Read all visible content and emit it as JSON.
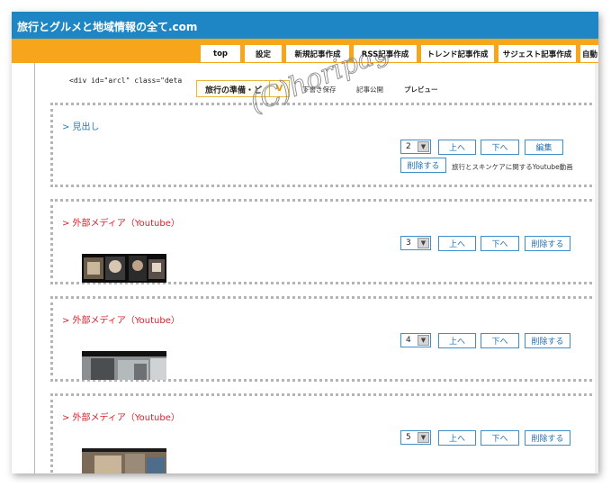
{
  "site": {
    "title": "旅行とグルメと地域情報の全て.com"
  },
  "nav": {
    "items": [
      {
        "label": "top"
      },
      {
        "label": "設定"
      },
      {
        "label": "新規記事作成"
      },
      {
        "label": "RSS記事作成"
      },
      {
        "label": "トレンド記事作成"
      },
      {
        "label": "サジェスト記事作成"
      },
      {
        "label": "自動"
      }
    ]
  },
  "editor": {
    "code_snippet": "<div id=\"arcl\" class=\"deta",
    "template_select": "旅行の準備・ど",
    "links": {
      "draft_save": "下書き保存",
      "publish": "記事公開",
      "preview": "プレビュー"
    }
  },
  "watermark": {
    "text": "(C)horipage"
  },
  "blocks": [
    {
      "type_label": "> 見出し",
      "order": "2",
      "buttons": {
        "up": "上へ",
        "down": "下へ",
        "edit": "編集",
        "delete": "削除する"
      },
      "caption": "旅行とスキンケアに関するYoutube動画"
    },
    {
      "type_label": "> 外部メディア（Youtube）",
      "order": "3",
      "buttons": {
        "up": "上へ",
        "down": "下へ",
        "delete": "削除する"
      }
    },
    {
      "type_label": "> 外部メディア（Youtube）",
      "order": "4",
      "buttons": {
        "up": "上へ",
        "down": "下へ",
        "delete": "削除する"
      }
    },
    {
      "type_label": "> 外部メディア（Youtube）",
      "order": "5",
      "buttons": {
        "up": "上へ",
        "down": "下へ",
        "delete": "削除する"
      }
    }
  ],
  "colors": {
    "header_blue": "#1e86c5",
    "nav_orange": "#f7a51a",
    "heading_blue": "#1f7fc4",
    "media_red": "#d81f2a",
    "button_border": "#3e8fc9"
  }
}
